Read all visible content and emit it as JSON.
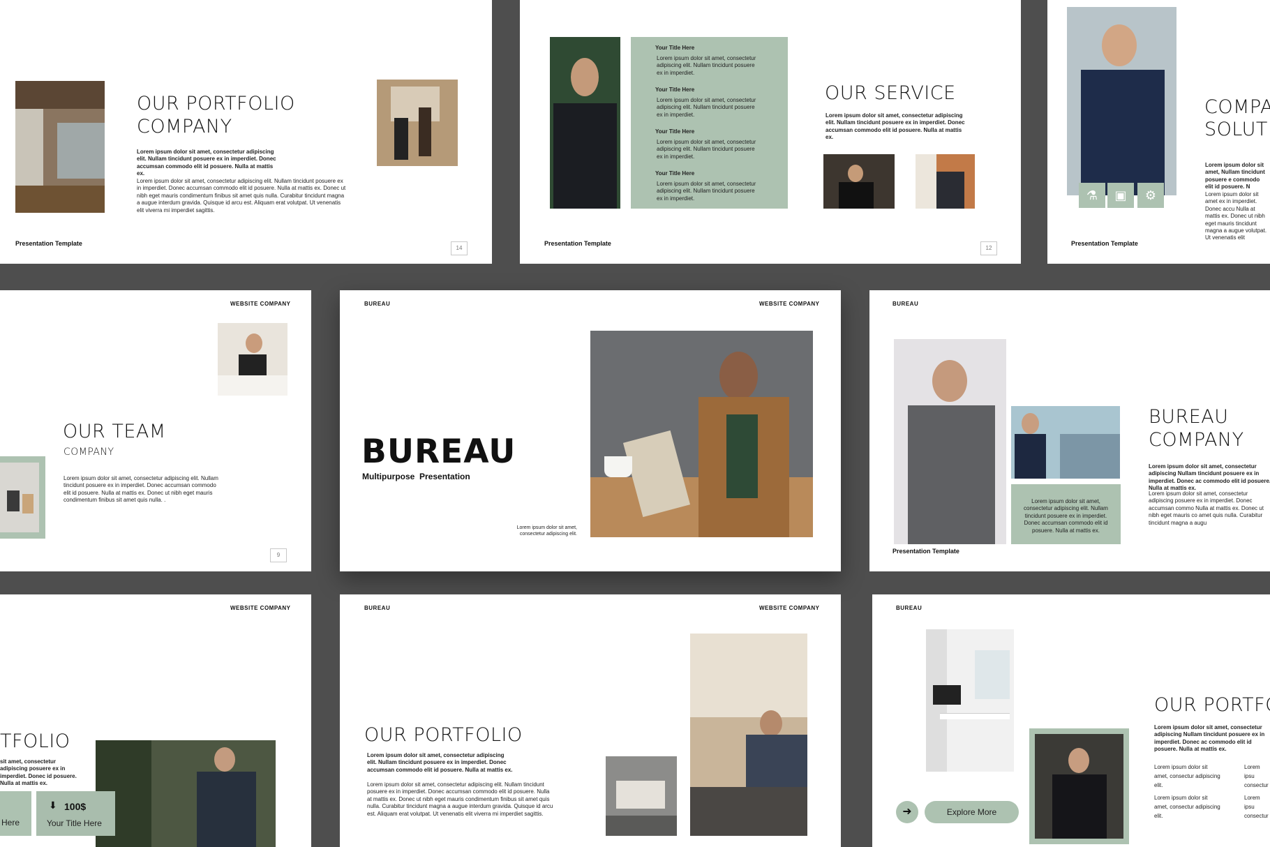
{
  "slides": {
    "s14": {
      "title_line1": "OUR PORTFOLIO",
      "title_line2": "COMPANY",
      "bold_text": "Lorem ipsum dolor sit amet, consectetur adipiscing elit. Nullam tincidunt posuere ex in imperdiet. Donec accumsan commodo elit id posuere. Nulla at mattis ex.",
      "body_text": "Lorem ipsum dolor sit amet, consectetur adipiscing elit. Nullam tincidunt posuere ex in imperdiet. Donec accumsan commodo elit id posuere. Nulla at mattis ex. Donec ut nibh eget mauris condimentum finibus sit amet quis nulla. Curabitur tincidunt magna a augue interdum gravida. Quisque id arcu est. Aliquam erat volutpat. Ut venenatis elit viverra mi imperdiet sagittis.",
      "footer": "Presentation Template",
      "page": "14"
    },
    "s12": {
      "items": [
        {
          "title": "Your Title Here",
          "text": "Lorem ipsum dolor sit amet, consectetur adipiscing elit. Nullam tincidunt posuere ex in imperdiet."
        },
        {
          "title": "Your Title Here",
          "text": "Lorem ipsum dolor sit amet, consectetur adipiscing elit. Nullam tincidunt posuere ex in imperdiet."
        },
        {
          "title": "Your Title Here",
          "text": "Lorem ipsum dolor sit amet, consectetur adipiscing elit. Nullam tincidunt posuere ex in imperdiet."
        },
        {
          "title": "Your Title Here",
          "text": "Lorem ipsum dolor sit amet, consectetur adipiscing elit. Nullam tincidunt posuere ex in imperdiet."
        }
      ],
      "title": "OUR SERVICE",
      "bold_text": "Lorem ipsum dolor sit amet, consectetur adipiscing elit. Nullam tincidunt posuere ex in imperdiet. Donec accumsan commodo elit id posuere. Nulla at mattis ex.",
      "footer": "Presentation Template",
      "page": "12"
    },
    "s_company": {
      "title_line1": "COMPA",
      "title_line2": "SOLUTIO",
      "bold_text": "Lorem ipsum dolor sit amet, Nullam tincidunt posuere e commodo elit id posuere. N",
      "body_text": "Lorem ipsum dolor sit amet ex in imperdiet. Donec accu Nulla at mattis ex. Donec ut nibh eget mauris tincidunt magna a augue volutpat. Ut venenatis elit",
      "footer": "Presentation Template"
    },
    "s9": {
      "tag": "WEBSITE COMPANY",
      "title": "OUR TEAM",
      "subtitle": "COMPANY",
      "body_text": "Lorem ipsum dolor sit amet, consectetur adipiscing elit. Nullam tincidunt posuere ex in imperdiet. Donec accumsan commodo elit id posuere. Nulla at mattis ex. Donec ut nibh eget mauris condimentum finibus sit amet quis nulla. .",
      "page": "9"
    },
    "s_main": {
      "brand": "BUREAU",
      "tag": "WEBSITE COMPANY",
      "title": "BUREAU",
      "subtitle": "Multipurpose  Presentation",
      "small_text": "Lorem ipsum dolor sit amet, consectetur adipiscing elit."
    },
    "s_bureau_company": {
      "brand": "BUREAU",
      "title_line1": "BUREAU",
      "title_line2": "COMPANY",
      "green_text": "Lorem ipsum dolor sit amet, consectetur adipiscing elit. Nullam tincidunt posuere ex in imperdiet. Donec accumsan commodo elit id posuere. Nulla at mattis ex.",
      "bold_text": "Lorem ipsum dolor sit amet, consectetur adipiscing Nullam tincidunt posuere ex in imperdiet. Donec ac commodo elit id posuere. Nulla at mattis ex.",
      "body_text": "Lorem ipsum dolor sit amet, consectetur adipiscing posuere ex in imperdiet. Donec accumsan commo Nulla at mattis ex. Donec ut nibh eget mauris co amet quis nulla. Curabitur tincidunt magna a augu",
      "footer": "Presentation Template"
    },
    "s_portfolio_left": {
      "tag": "WEBSITE COMPANY",
      "title": "TFOLIO",
      "bold_text": "sit amet, consectetur adipiscing posuere ex in imperdiet. Donec id posuere. Nulla at mattis ex.",
      "card1_label": "Here",
      "card2_price": "100$",
      "card2_label": "Your Title Here"
    },
    "s_portfolio_mid": {
      "brand": "BUREAU",
      "tag": "WEBSITE COMPANY",
      "title": "OUR PORTFOLIO",
      "bold_text": "Lorem ipsum dolor sit amet, consectetur adipiscing elit. Nullam tincidunt posuere ex in imperdiet. Donec accumsan commodo elit id posuere. Nulla at mattis ex.",
      "body_text": "Lorem ipsum dolor sit amet, consectetur adipiscing elit. Nullam tincidunt posuere ex in imperdiet. Donec accumsan commodo elit id posuere. Nulla at mattis ex. Donec ut nibh eget mauris condimentum finibus sit amet quis nulla. Curabitur tincidunt magna a augue interdum gravida. Quisque id arcu est. Aliquam erat volutpat. Ut venenatis elit viverra mi imperdiet sagittis."
    },
    "s_portfolio_right": {
      "brand": "BUREAU",
      "title": "OUR PORTFO",
      "bold_text": "Lorem ipsum dolor sit amet, consectetur adipiscing Nullam tincidunt posuere ex in imperdiet. Donec ac commodo elit id posuere. Nulla at mattis ex.",
      "col1_a": "Lorem ipsum dolor sit amet, consectur adipiscing elit.",
      "col1_b": "Lorem ipsum dolor sit amet, consectur adipiscing elit.",
      "col2_a": "Lorem ipsu consectur",
      "col2_b": "Lorem ipsu consectur",
      "button_label": "Explore More"
    }
  },
  "colors": {
    "background": "#4e4e4e",
    "accent_green": "#adc2b1",
    "slide": "#ffffff"
  },
  "icons": [
    "flask-icon",
    "image-icon",
    "gear-icon",
    "arrow-right-icon",
    "download-icon"
  ]
}
